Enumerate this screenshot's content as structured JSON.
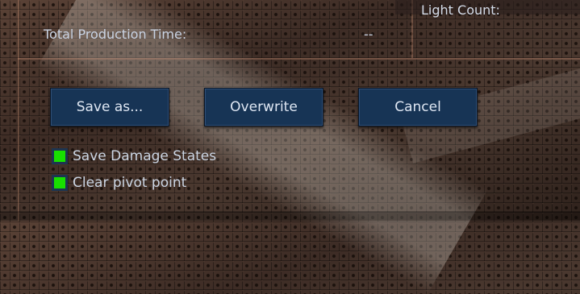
{
  "stats": {
    "light_count_label": "Light Count:",
    "production_time_label": "Total Production Time:",
    "production_time_value": "--"
  },
  "buttons": {
    "save_as": "Save as...",
    "overwrite": "Overwrite",
    "cancel": "Cancel"
  },
  "options": [
    {
      "label": "Save Damage States",
      "checked": true
    },
    {
      "label": "Clear pivot point",
      "checked": true
    }
  ],
  "colors": {
    "button_bg": "#173455",
    "checkbox_checked": "#18e000",
    "text": "#c9d3e3"
  }
}
